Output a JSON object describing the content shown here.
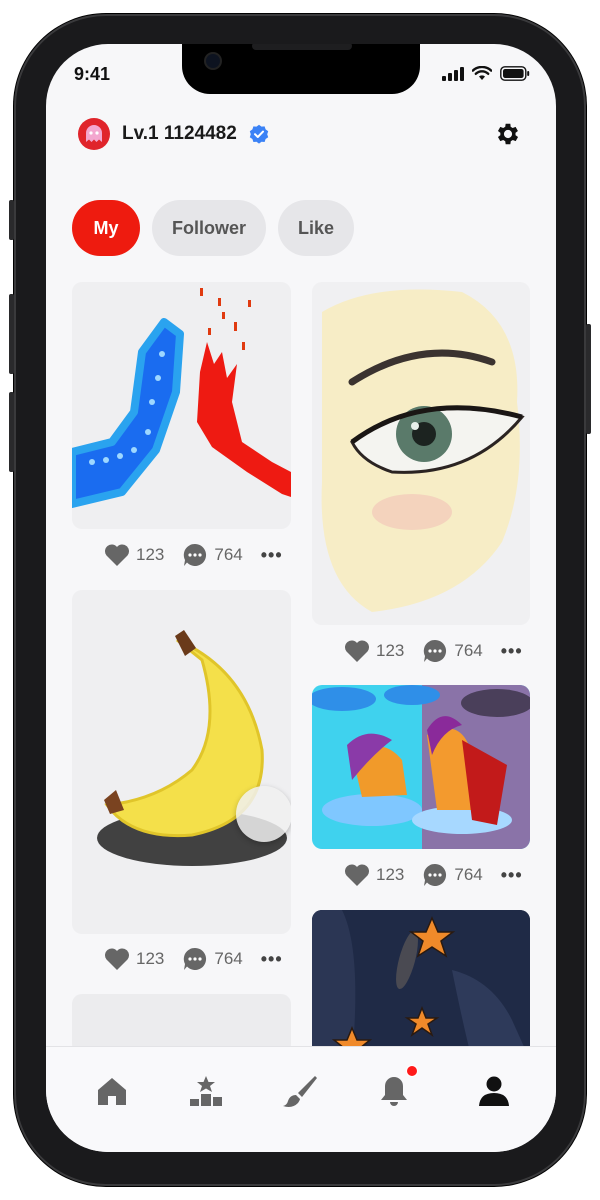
{
  "status_bar": {
    "time": "9:41"
  },
  "header": {
    "username": "Lv.1 1124482"
  },
  "tabs": [
    {
      "label": "My",
      "active": true
    },
    {
      "label": "Follower",
      "active": false
    },
    {
      "label": "Like",
      "active": false
    }
  ],
  "posts": [
    {
      "subject": "high-five hands drawing",
      "likes": "123",
      "comments": "764"
    },
    {
      "subject": "eye painting",
      "likes": "123",
      "comments": "764"
    },
    {
      "subject": "banana drawing",
      "likes": "123",
      "comments": "764"
    },
    {
      "subject": "ponies on clouds drawing",
      "likes": "123",
      "comments": "764"
    },
    {
      "subject": "night sea with starfish drawing"
    }
  ],
  "more_label": "•••",
  "bottom_nav": [
    "home-icon",
    "ranking-icon",
    "paint-brush-icon",
    "bell-icon",
    "profile-icon"
  ],
  "colors": {
    "accent": "#ee1b0f",
    "verified": "#3b82f6",
    "tab_inactive": "#e6e6e9"
  }
}
